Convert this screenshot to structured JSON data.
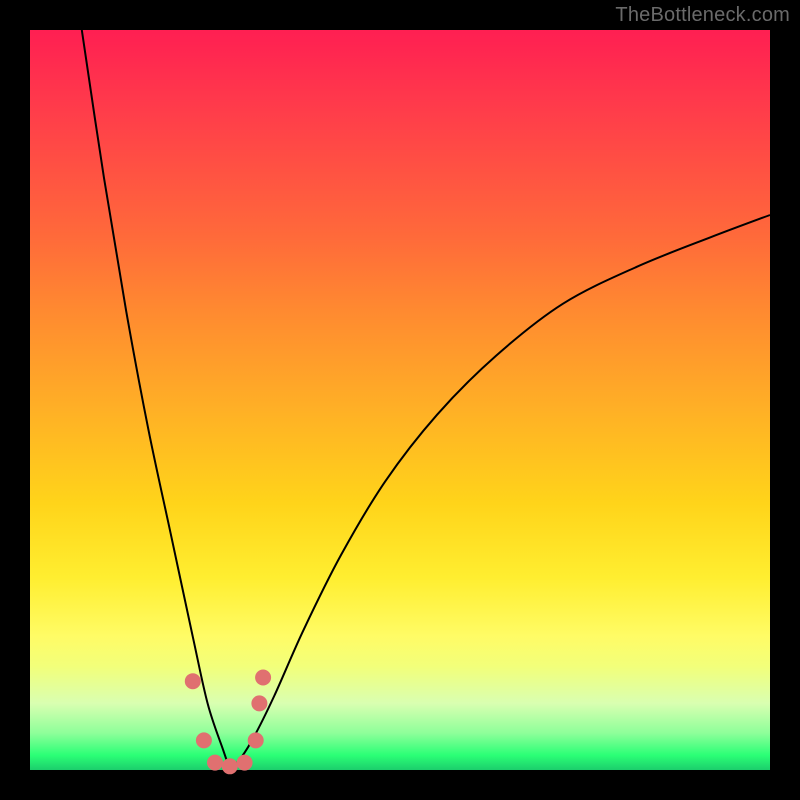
{
  "watermark": "TheBottleneck.com",
  "colors": {
    "frame": "#000000",
    "curve": "#000000",
    "marker": "#e07070",
    "gradient_top": "#ff1f52",
    "gradient_mid": "#ffd41a",
    "gradient_bottom": "#1cce6c"
  },
  "chart_data": {
    "type": "line",
    "title": "",
    "xlabel": "",
    "ylabel": "",
    "xlim": [
      0,
      100
    ],
    "ylim": [
      0,
      100
    ],
    "description": "Bottleneck curve: V-shaped mismatch profile. x is an abstract balance axis; y is mismatch severity (0 = green / no bottleneck, 100 = red / severe). Minimum ~0 at x≈27; left branch rises steeply to 100 at x≈7; right branch rises gradually toward ~75 at x=100.",
    "series": [
      {
        "name": "bottleneck-curve",
        "x": [
          7,
          10,
          13,
          16,
          19,
          22,
          24,
          26,
          27,
          28,
          30,
          33,
          37,
          42,
          48,
          55,
          63,
          72,
          82,
          92,
          100
        ],
        "values": [
          100,
          80,
          62,
          46,
          32,
          18,
          9,
          3,
          0.5,
          1,
          4,
          10,
          19,
          29,
          39,
          48,
          56,
          63,
          68,
          72,
          75
        ]
      }
    ],
    "markers": [
      {
        "x": 22.0,
        "y": 12.0
      },
      {
        "x": 23.5,
        "y": 4.0
      },
      {
        "x": 25.0,
        "y": 1.0
      },
      {
        "x": 27.0,
        "y": 0.5
      },
      {
        "x": 29.0,
        "y": 1.0
      },
      {
        "x": 30.5,
        "y": 4.0
      },
      {
        "x": 31.0,
        "y": 9.0
      },
      {
        "x": 31.5,
        "y": 12.5
      }
    ]
  }
}
